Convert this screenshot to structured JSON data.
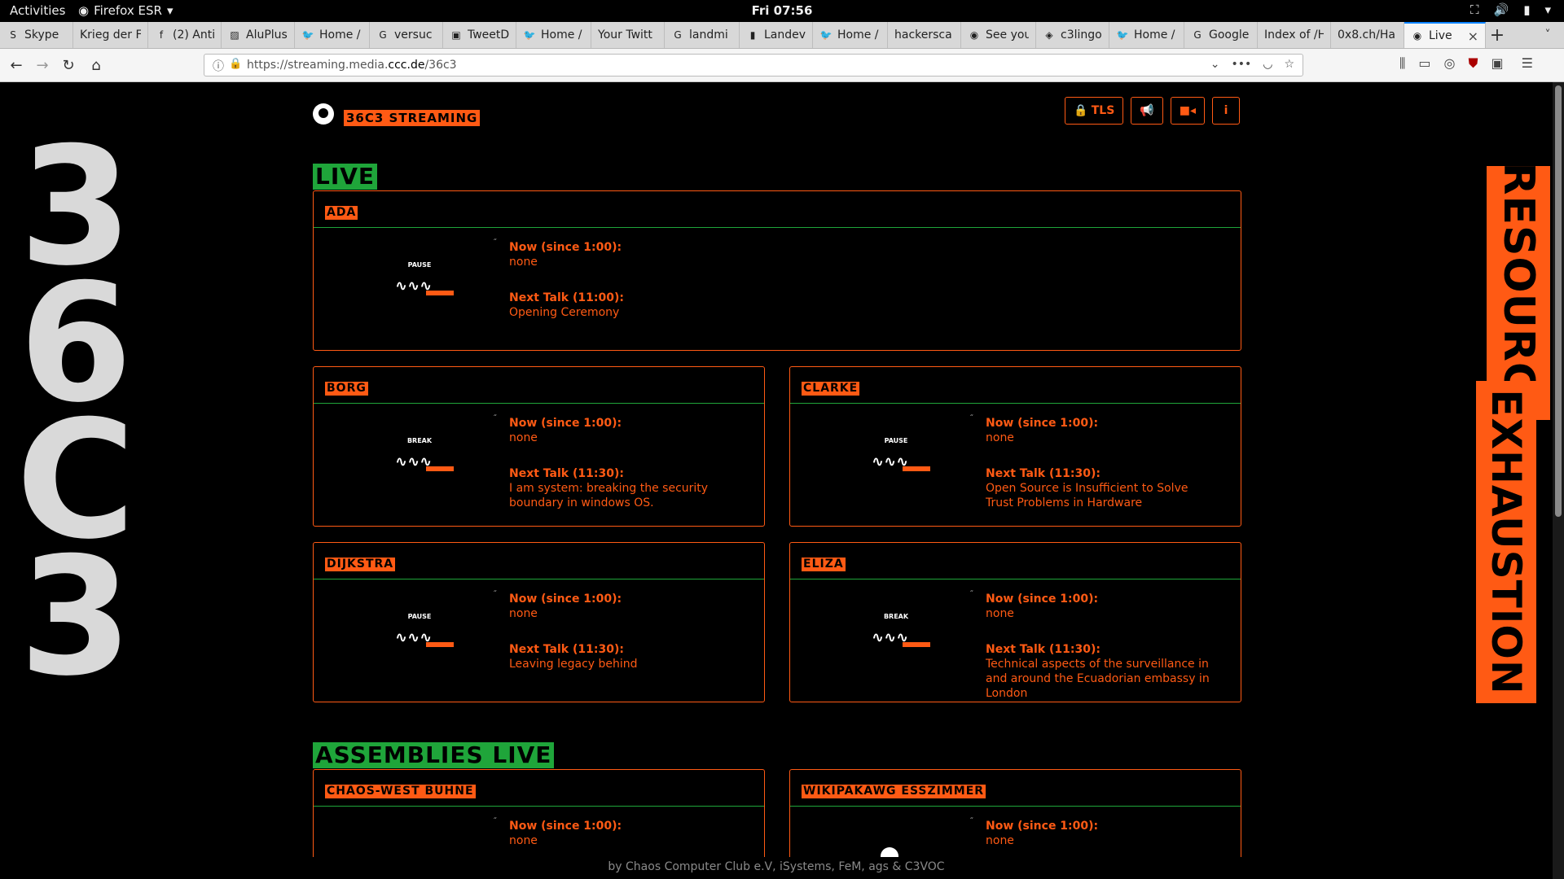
{
  "gnome": {
    "activities": "Activities",
    "app": "Firefox ESR",
    "clock": "Fri 07:56"
  },
  "tabs": [
    {
      "label": "Skype",
      "icon": "skype-icon"
    },
    {
      "label": "Krieg der F",
      "icon": "none"
    },
    {
      "label": "(2) Anti",
      "icon": "facebook-icon"
    },
    {
      "label": "AluPlus",
      "icon": "aluplus-icon"
    },
    {
      "label": "Home /",
      "icon": "twitter-icon"
    },
    {
      "label": "versuc",
      "icon": "google-icon"
    },
    {
      "label": "TweetD",
      "icon": "tweetdeck-icon"
    },
    {
      "label": "Home /",
      "icon": "twitter-icon"
    },
    {
      "label": "Your Twitt",
      "icon": "none"
    },
    {
      "label": "landmi",
      "icon": "google-icon"
    },
    {
      "label": "Landev",
      "icon": "pdf-icon"
    },
    {
      "label": "Home /",
      "icon": "twitter-icon"
    },
    {
      "label": "hackersca",
      "icon": "none"
    },
    {
      "label": "See you",
      "icon": "ccc-icon"
    },
    {
      "label": "c3lingo",
      "icon": "c3lingo-icon"
    },
    {
      "label": "Home /",
      "icon": "twitter-icon"
    },
    {
      "label": "Google",
      "icon": "google-translate-icon"
    },
    {
      "label": "Index of /H",
      "icon": "none"
    },
    {
      "label": "0x8.ch/Ha",
      "icon": "none"
    },
    {
      "label": "Live",
      "icon": "ccc-icon",
      "active": true
    }
  ],
  "nav": {
    "url_prefix": "https://streaming.media.",
    "url_domain": "ccc.de",
    "url_suffix": "/36c3"
  },
  "page": {
    "brand": "36C3 STREAMING",
    "deco_left": [
      "3",
      "6",
      "C",
      "3"
    ],
    "deco_right": [
      "RESOURCE",
      "EXHAUSTION"
    ],
    "buttons": {
      "tls": "TLS"
    },
    "live_heading": "LIVE",
    "assemblies_heading": "ASSEMBLIES LIVE",
    "now_prefix": "Now (since 1:00):",
    "rooms": [
      {
        "name": "ADA",
        "state": "PAUSE",
        "now": "none",
        "next_label": "Next Talk (11:00):",
        "next": "Opening Ceremony"
      },
      {
        "name": "BORG",
        "state": "BREAK",
        "now": "none",
        "next_label": "Next Talk (11:30):",
        "next": "I am system: breaking the security boundary in windows OS."
      },
      {
        "name": "CLARKE",
        "state": "PAUSE",
        "now": "none",
        "next_label": "Next Talk (11:30):",
        "next": "Open Source is Insufficient to Solve Trust Problems in Hardware"
      },
      {
        "name": "DIJKSTRA",
        "state": "PAUSE",
        "now": "none",
        "next_label": "Next Talk (11:30):",
        "next": "Leaving legacy behind"
      },
      {
        "name": "ELIZA",
        "state": "BREAK",
        "now": "none",
        "next_label": "Next Talk (11:30):",
        "next": "Technical aspects of the surveillance in and around the Ecuadorian embassy in London"
      }
    ],
    "assemblies": [
      {
        "name": "CHAOS-WEST BÜHNE",
        "now": "none"
      },
      {
        "name": "WIKIPAKAWG ESSZIMMER",
        "now": "none"
      }
    ],
    "footer": "by Chaos Computer Club e.V, iSystems, FeM, ags & C3VOC"
  },
  "colors": {
    "accent": "#ff5a14",
    "green": "#1fa53a",
    "bg": "#000000"
  }
}
